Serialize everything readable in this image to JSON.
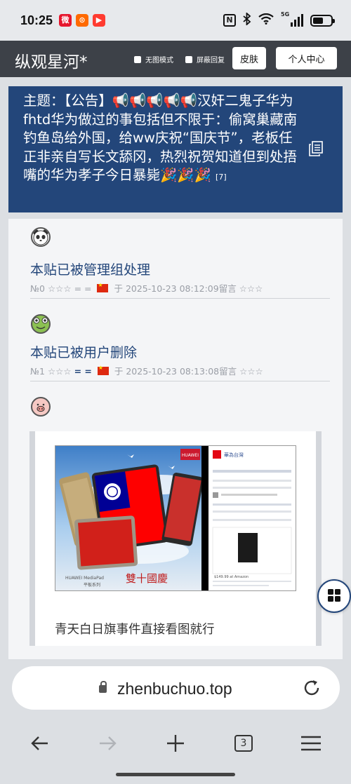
{
  "status_bar": {
    "time": "10:25",
    "apps": [
      {
        "name": "weibo-app-icon",
        "glyph": "微",
        "color": "#e6162d"
      },
      {
        "name": "app-icon-orange",
        "glyph": "⊙",
        "color": "#ff6a00"
      },
      {
        "name": "video-app-icon",
        "glyph": "▶",
        "color": "#ff3b30"
      }
    ],
    "nfc": "N",
    "network": "5G"
  },
  "site": {
    "title": "纵观星河*",
    "option_no_image": "无图模式",
    "option_block_replies": "屏蔽回复",
    "skin_button": "皮肤",
    "user_center_button": "个人中心"
  },
  "topic": {
    "text": "主题：【公告】📢📢📢📢📢汉奸二鬼子华为fhtd华为做过的事包括但不限于：偷窝巢藏南钓鱼岛给外国，给ww庆祝“国庆节”，老板任正非亲自写长文舔冈，热烈祝贺知道但到处捂嘴的华为孝子今日暴毙🎉🎉🎉",
    "reply_count": "[7]"
  },
  "posts": [
    {
      "avatar": "panda-avatar",
      "title": "本贴已被管理组处理",
      "index": "№0",
      "rating_left": "☆☆☆",
      "marks": "= =",
      "time_prefix": "于",
      "timestamp": "2025-10-23 08:12:09",
      "suffix": "留言",
      "rating_right": "☆☆☆"
    },
    {
      "avatar": "frog-avatar",
      "title": "本贴已被用户删除",
      "index": "№1",
      "rating_left": "☆☆☆",
      "marks": "= =",
      "time_prefix": "于",
      "timestamp": "2025-10-23 08:13:08",
      "suffix": "留言",
      "rating_right": "☆☆☆"
    },
    {
      "avatar": "pig-avatar",
      "content_text": "青天白日旗事件直接看图就行",
      "image": {
        "brand": "HUAWEI",
        "product_line": "HUAWEI MediaPad",
        "series_text": "平板系列",
        "banner_text": "雙十國慶",
        "page_title": "華為台灣",
        "price_text": "$149.99 at Amazon"
      }
    }
  ],
  "browser": {
    "url": "zhenbuchuo.top",
    "tab_count": "3"
  },
  "colors": {
    "header_bg": "#3d4148",
    "topic_bg": "#23467a",
    "link": "#23467a"
  }
}
